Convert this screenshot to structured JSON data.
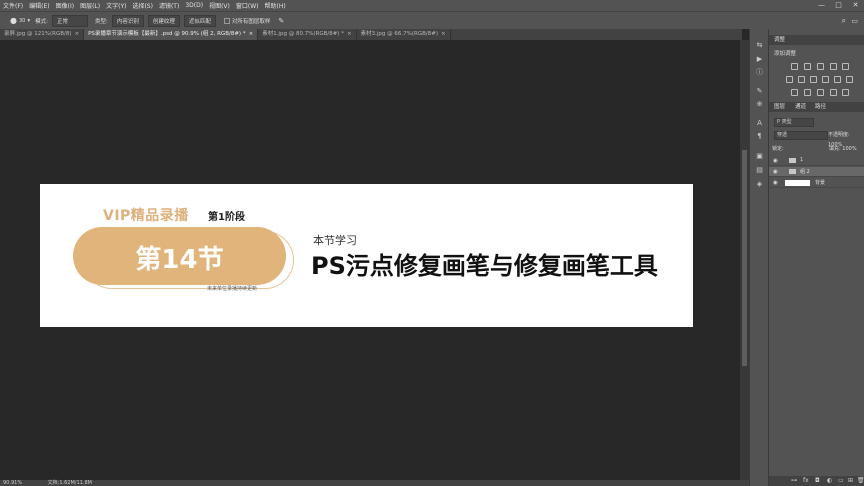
{
  "menu": [
    "文件(F)",
    "编辑(E)",
    "图像(I)",
    "图层(L)",
    "文字(Y)",
    "选择(S)",
    "滤镜(T)",
    "3D(D)",
    "视图(V)",
    "窗口(W)",
    "帮助(H)"
  ],
  "window_controls": [
    "—",
    "□",
    "✕"
  ],
  "options": {
    "brush_size": "30",
    "mode_label": "模式:",
    "mode_value": "正常",
    "type_label": "类型:",
    "type_options": [
      "内容识别",
      "创建纹理",
      "近似匹配"
    ],
    "sample_all_label": "对所有图层取样"
  },
  "tabs": [
    {
      "label": "录屏.jpg @ 121%(RGB/8)",
      "close": "×",
      "active": false
    },
    {
      "label": "PS录播章节演示模板【最新】.psd @ 90.9% (组 2, RGB/8#) *",
      "close": "×",
      "active": true
    },
    {
      "label": "素材1.jpg @ 80.7%(RGB/8#) *",
      "close": "×",
      "active": false
    },
    {
      "label": "素材3.jpg @ 66.7%(RGB/8#)",
      "close": "×",
      "active": false
    }
  ],
  "document": {
    "vip_text": "VIP精品录播",
    "stage_text": "第1阶段",
    "lesson_text": "第14节",
    "tiny_text": "未来单位录播持续更新",
    "subtitle": "本节学习",
    "headline": "PS污点修复画笔与修复画笔工具"
  },
  "status": {
    "zoom": "90.91%",
    "doc_info": "文档:1.62M/11.8M"
  },
  "panels": {
    "adjust_tab": "调整",
    "adjust_title": "添加调整",
    "layer_tabs": [
      "图层",
      "通道",
      "路径"
    ],
    "kind_label": "P 类型",
    "blend_mode": "穿透",
    "opacity_label": "不透明度: 100%",
    "lock_label": "锁定:",
    "fill_label": "填充: 100%",
    "layers": [
      {
        "name": "1",
        "kind": "folder"
      },
      {
        "name": "组 2",
        "kind": "folder",
        "selected": true
      },
      {
        "name": "背景",
        "kind": "image"
      }
    ]
  },
  "colors": {
    "gold": "#e1b47c",
    "panel": "#535353",
    "canvas_bg": "#282828"
  }
}
